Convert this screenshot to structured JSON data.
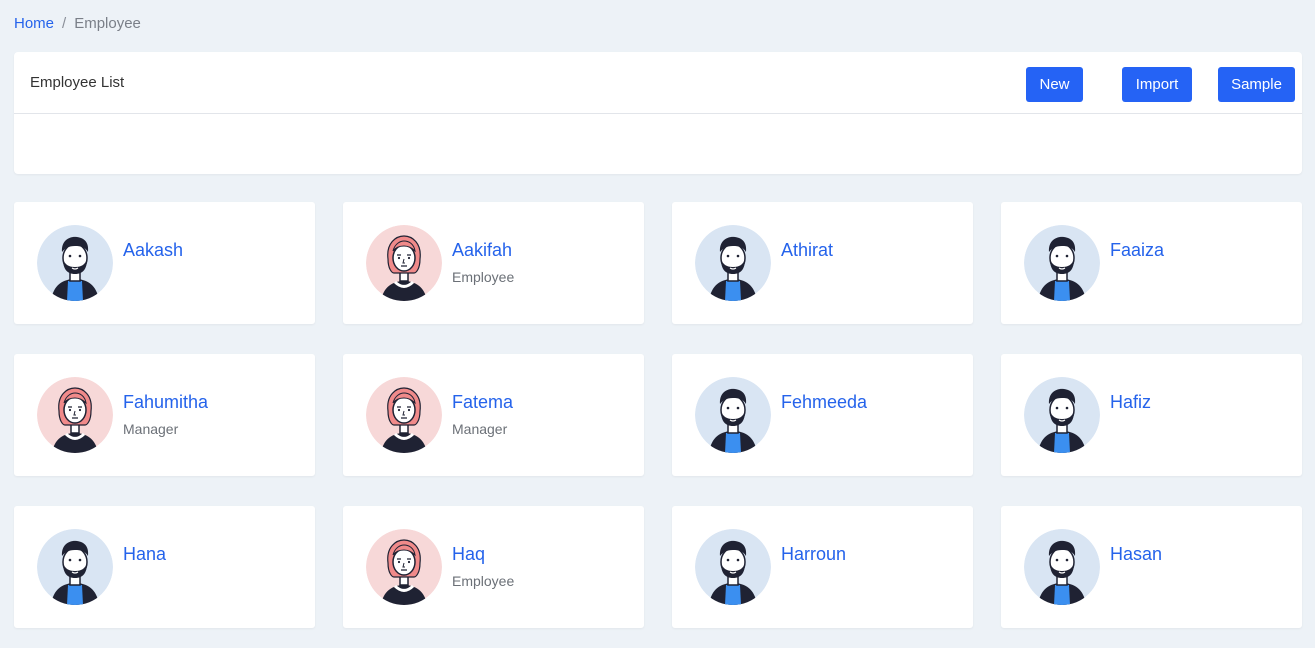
{
  "breadcrumb": {
    "home": "Home",
    "separator": "/",
    "current": "Employee"
  },
  "panel": {
    "title": "Employee List",
    "buttons": {
      "new": "New",
      "import": "Import",
      "sample": "Sample"
    }
  },
  "colors": {
    "accent": "#2563f5",
    "link": "#2563eb",
    "background": "#edf2f7",
    "male_avatar_bg": "#d9e5f3",
    "female_avatar_bg": "#f7d8d8"
  },
  "employees": [
    {
      "name": "Aakash",
      "role": "",
      "avatar": "male-avatar-icon"
    },
    {
      "name": "Aakifah",
      "role": "Employee",
      "avatar": "female-avatar-icon"
    },
    {
      "name": "Athirat",
      "role": "",
      "avatar": "male-avatar-icon"
    },
    {
      "name": "Faaiza",
      "role": "",
      "avatar": "male-avatar-icon"
    },
    {
      "name": "Fahumitha",
      "role": "Manager",
      "avatar": "female-avatar-icon"
    },
    {
      "name": "Fatema",
      "role": "Manager",
      "avatar": "female-avatar-icon"
    },
    {
      "name": "Fehmeeda",
      "role": "",
      "avatar": "male-avatar-icon"
    },
    {
      "name": "Hafiz",
      "role": "",
      "avatar": "male-avatar-icon"
    },
    {
      "name": "Hana",
      "role": "",
      "avatar": "male-avatar-icon"
    },
    {
      "name": "Haq",
      "role": "Employee",
      "avatar": "female-avatar-icon"
    },
    {
      "name": "Harroun",
      "role": "",
      "avatar": "male-avatar-icon"
    },
    {
      "name": "Hasan",
      "role": "",
      "avatar": "male-avatar-icon"
    }
  ]
}
